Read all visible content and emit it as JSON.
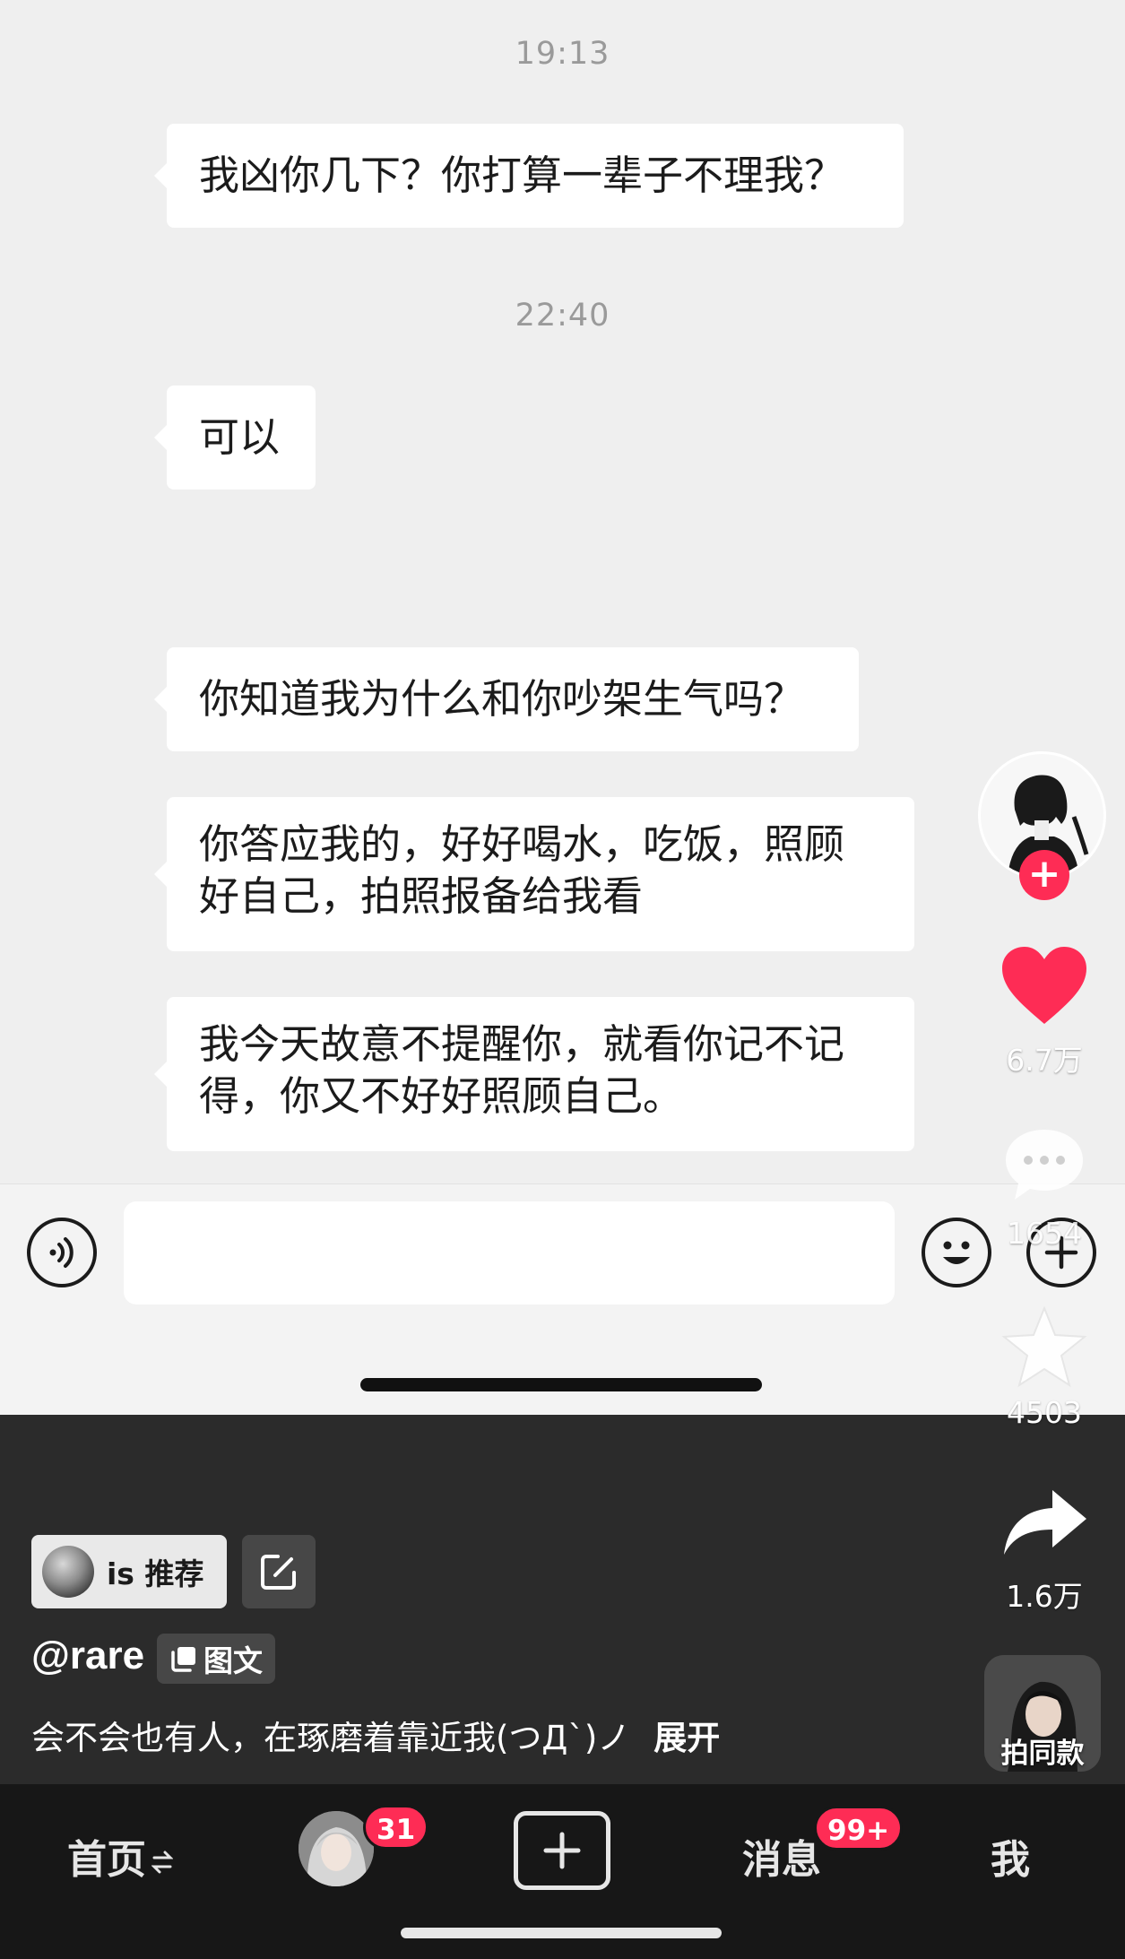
{
  "chat": {
    "timestamps": [
      "19:13",
      "22:40"
    ],
    "messages": [
      "我凶你几下？你打算一辈子不理我？",
      "可以",
      "你知道我为什么和你吵架生气吗？",
      "你答应我的，好好喝水，吃饭，照顾好自己，拍照报备给我看",
      "我今天故意不提醒你，就看你记不记得，你又不好好照顾自己。"
    ],
    "input": {
      "value": "",
      "placeholder": ""
    }
  },
  "post": {
    "recommend_label": "is 推荐",
    "username": "@rare",
    "type_badge": "图文",
    "caption": "会不会也有人，在琢磨着靠近我(つД`)ノ",
    "expand_label": "展开"
  },
  "rail": {
    "likes": "6.7万",
    "comments": "1654",
    "favorites": "4503",
    "shares": "1.6万",
    "same_style_label": "拍同款",
    "icons": [
      "follow-plus-icon",
      "heart-icon",
      "comment-icon",
      "star-icon",
      "share-icon"
    ]
  },
  "tabbar": {
    "home": "首页",
    "friends_badge": "31",
    "messages": "消息",
    "messages_badge": "99+",
    "me": "我"
  },
  "colors": {
    "accent": "#fe2c55",
    "tabbar": "#171717",
    "overlay": "#2b2b2b",
    "chat_bg": "#efefef"
  }
}
